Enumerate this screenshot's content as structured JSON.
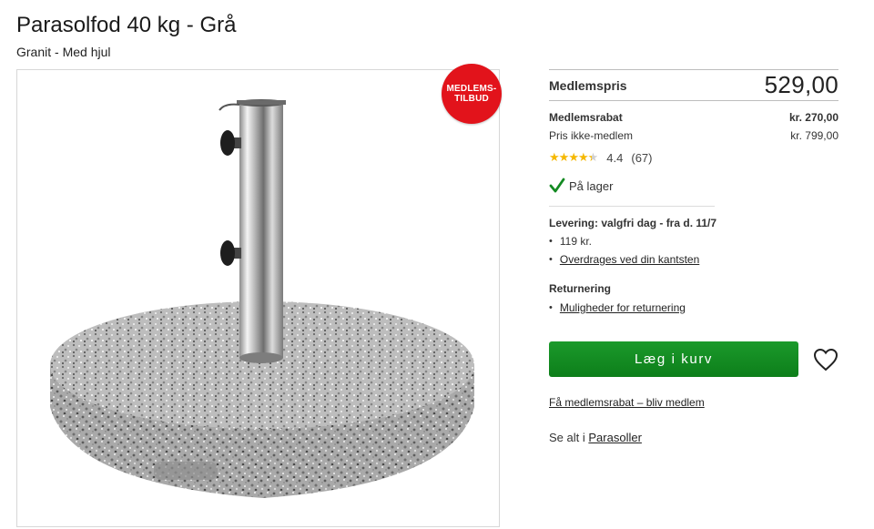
{
  "product": {
    "title": "Parasolfod 40 kg - Grå",
    "subtitle": "Granit - Med hjul",
    "badge_line1": "MEDLEMS-",
    "badge_line2": "TILBUD"
  },
  "pricing": {
    "member_price_label": "Medlemspris",
    "member_price": "529,00",
    "discount_label": "Medlemsrabat",
    "discount_value": "kr. 270,00",
    "non_member_label": "Pris ikke-medlem",
    "non_member_value": "kr. 799,00"
  },
  "rating": {
    "score": "4.4",
    "count": "(67)",
    "fraction": 0.88
  },
  "stock": {
    "label": "På lager"
  },
  "delivery": {
    "heading": "Levering: valgfri dag - fra d. 11/7",
    "items": [
      "119 kr.",
      "Overdrages ved din kantsten"
    ]
  },
  "returns": {
    "heading": "Returnering",
    "items": [
      "Muligheder for returnering"
    ]
  },
  "actions": {
    "add_to_cart": "Læg i kurv",
    "membership_link": "Få medlemsrabat – bliv medlem",
    "see_all_prefix": "Se alt i",
    "see_all_link": "Parasoller"
  },
  "colors": {
    "accent_green": "#138a22",
    "badge_red": "#e2131b",
    "star_yellow": "#f5b800"
  },
  "icons": {
    "wishlist": "heart-icon",
    "stock": "checkmark-icon"
  }
}
